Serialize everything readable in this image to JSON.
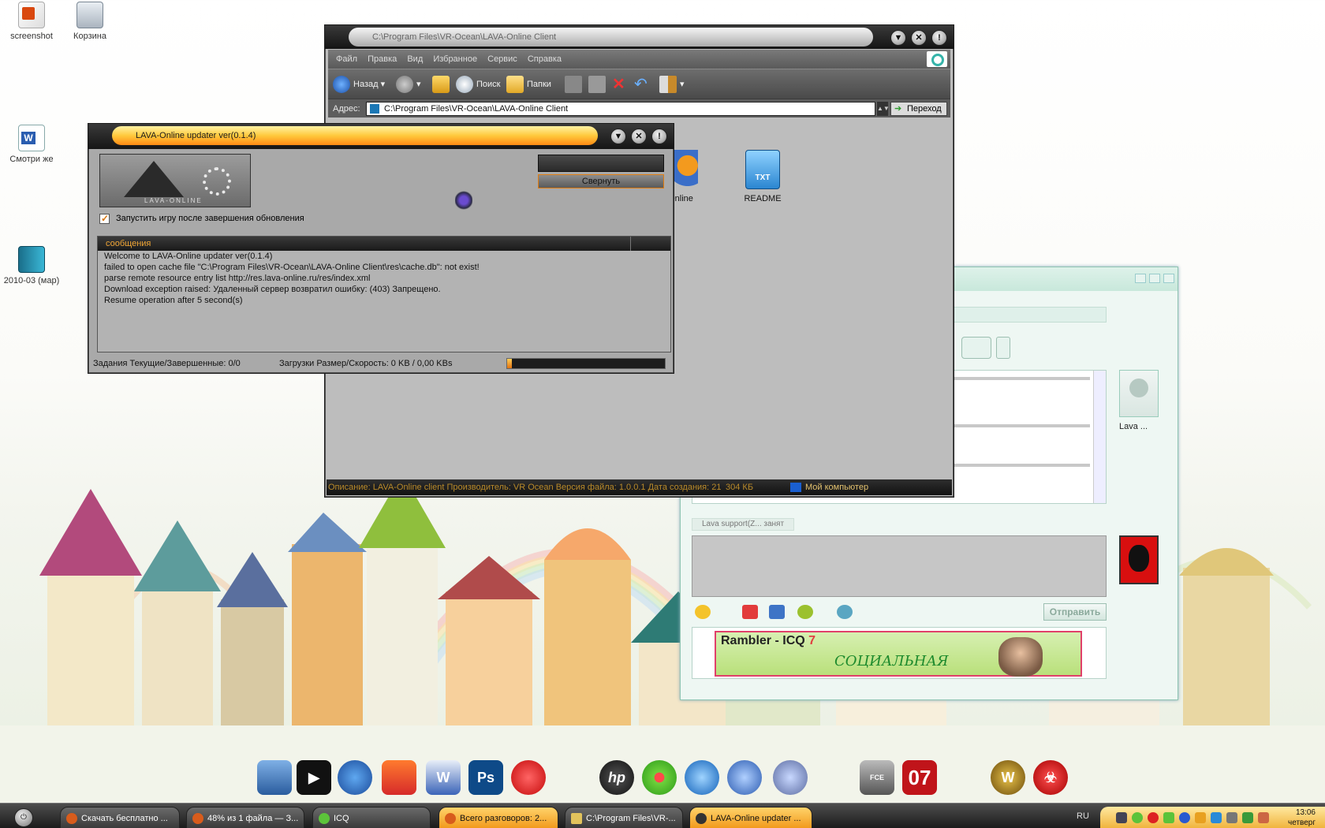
{
  "desktop": {
    "icons": [
      {
        "label": "screenshot",
        "icon": "powerpoint-icon"
      },
      {
        "label": "Корзина",
        "icon": "recycle-bin-icon"
      },
      {
        "label": "Смотри же",
        "icon": "word-document-icon"
      },
      {
        "label": "2010-03 (мар)",
        "icon": "book-icon"
      }
    ]
  },
  "explorer": {
    "title": "C:\\Program Files\\VR-Ocean\\LAVA-Online Client",
    "menu": [
      "Файл",
      "Правка",
      "Вид",
      "Избранное",
      "Сервис",
      "Справка"
    ],
    "toolbar": {
      "back": "Назад",
      "search": "Поиск",
      "folders": "Папки"
    },
    "address_label": "Адрес:",
    "address_value": "C:\\Program Files\\VR-Ocean\\LAVA-Online Client",
    "go_label": "Переход",
    "files": [
      {
        "label": "Online",
        "icon": "firefox-shortcut-icon"
      },
      {
        "label": "README",
        "icon": "txt-file-icon",
        "badge": "TXT"
      }
    ],
    "status": {
      "description": "Описание: LAVA-Online client Производитель: VR Ocean Версия файла: 1.0.0.1 Дата создания: 21",
      "size": "304 КБ",
      "zone": "Мой компьютер"
    }
  },
  "updater": {
    "title": "LAVA-Online updater ver(0.1.4)",
    "logo_text": "LAVA-ONLINE",
    "minimize_button": "Свернуть",
    "checkbox_label": "Запустить игру после завершения обновления",
    "checkbox_checked": true,
    "log_header": "сообщения",
    "log_lines": [
      "Welcome to LAVA-Online updater ver(0.1.4)",
      "failed to open cache file \"C:\\Program Files\\VR-Ocean\\LAVA-Online Client\\res\\cache.db\": not exist!",
      "parse remote resource entry list http://res.lava-online.ru/res/index.xml",
      "Download exception raised: Удаленный сервер возвратил ошибку: (403) Запрещено.",
      "Resume operation after 5 second(s)"
    ],
    "status_tasks": "Задания Текущие/Завершенные:  0/0",
    "status_downloads": "Загрузки Размер/Скорость:  0 KB / 0,00 KBs",
    "progress": 0.03
  },
  "icq": {
    "contact_name": "Lava ...",
    "status_tab": "Lava support(Z... занят",
    "send_button": "Отправить",
    "banner": {
      "title": "Rambler - ICQ",
      "version": "7",
      "subtitle": "СОЦИАЛЬНАЯ"
    }
  },
  "dock": [
    "laptop-icon",
    "media-player-icon",
    "network-icon",
    "sync-icon",
    "word-icon",
    "photoshop-icon",
    "opera-icon",
    "hp-icon",
    "icq-icon",
    "google-earth-icon",
    "globe-icon",
    "audio-icon",
    "fceultra-icon",
    "07-icon",
    "warcraft-icon",
    "biohazard-icon"
  ],
  "dock_labels": {
    "ps": "Ps",
    "hp": "hp",
    "fce": "FCE ULTRA",
    "o7": "07",
    "w": "W"
  },
  "taskbar": {
    "tasks": [
      {
        "label": "Скачать бесплатно ..."
      },
      {
        "label": "48% из 1 файла — З..."
      },
      {
        "label": "ICQ"
      },
      {
        "label": "Всего разговоров: 2..."
      },
      {
        "label": "C:\\Program Files\\VR-..."
      },
      {
        "label": "LAVA-Online updater ..."
      }
    ],
    "language": "RU",
    "time": "13:06",
    "day": "четверг"
  }
}
